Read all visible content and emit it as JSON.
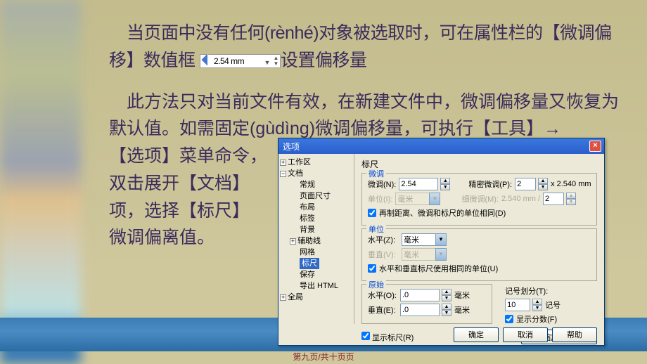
{
  "slide": {
    "p1a": "当页面中没有任何(rènhé)对象被选取时，可在属性栏的【微调偏移】数值框",
    "p1b": "设置偏移量",
    "nudge_value": "2.54 mm",
    "p2": "此方法只对当前文件有效，在新建文件中，微调偏移量又恢复为默认值。如需固定(gùdìng)微调偏移量，可执行【工具】→",
    "p3": "【选项】菜单命令，",
    "p4": "双击展开【文档】",
    "p5": "项，选择【标尺】",
    "p6": "微调偏离值。"
  },
  "dialog": {
    "title": "选项",
    "close": "×",
    "tree": {
      "workspace": "工作区",
      "document": "文档",
      "general": "常规",
      "page_size": "页面尺寸",
      "layout": "布局",
      "label": "标签",
      "background": "背景",
      "guides": "辅助线",
      "grid": "网格",
      "rulers": "标尺",
      "save": "保存",
      "export_html": "导出 HTML",
      "global": "全局"
    },
    "panel": {
      "title": "标尺",
      "group_nudge": "微调",
      "nudge_label": "微调(N):",
      "nudge_val": "2.54",
      "precise_label": "精密微调(P):",
      "precise_val": "2",
      "precise_suffix": "x 2.540 mm",
      "units_label": "单位(I):",
      "units_val": "毫米",
      "fine_label": "细微调(M):",
      "fine_val": "2.540 mm /",
      "fine_val2": "2",
      "same_units_chk": "再制距离、微调和标尺的单位相同(D)",
      "group_units": "单位",
      "horiz_label": "水平(Z):",
      "horiz_val": "毫米",
      "vert_label": "垂直(V):",
      "vert_val": "毫米",
      "same_hv_chk": "水平和垂直标尺使用相同的单位(U)",
      "group_origin": "原始",
      "origin_h_label": "水平(O):",
      "origin_h_val": ".0",
      "origin_h_unit": "毫米",
      "origin_v_label": "垂直(E):",
      "origin_v_val": ".0",
      "origin_v_unit": "毫米",
      "tick_div_label": "记号划分(T):",
      "tick_div_val": "10",
      "tick_div_unit": "记号",
      "show_frac_chk": "显示分数(F)",
      "show_rulers_chk": "显示标尺(R)",
      "edit_scale_btn": "编辑缩放比例(S)..."
    },
    "buttons": {
      "ok": "确定",
      "cancel": "取消",
      "help": "帮助"
    }
  },
  "footer": "第九页/共十页页"
}
